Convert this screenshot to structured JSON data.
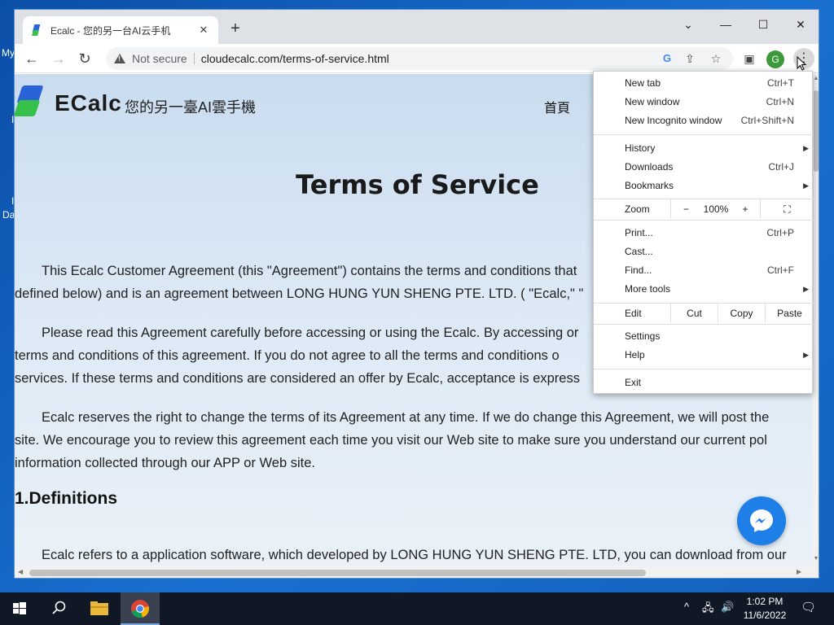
{
  "desktop": {
    "labels": [
      "My",
      "I",
      "I",
      "Da"
    ]
  },
  "browser": {
    "tab": {
      "title": "Ecalc - 您的另一台AI云手机",
      "close": "✕"
    },
    "new_tab": "+",
    "window_controls": {
      "dropdown": "⌄",
      "minimize": "—",
      "maximize": "☐",
      "close": "✕"
    },
    "toolbar": {
      "security_label": "Not secure",
      "url": "cloudecalc.com/terms-of-service.html",
      "profile_initial": "G"
    }
  },
  "page": {
    "site_name": "ECalc",
    "tagline": "您的另一臺AI雲手機",
    "nav_home": "首頁",
    "title": "Terms of Service",
    "paragraphs": [
      {
        "lines": [
          "This Ecalc Customer Agreement (this \"Agreement\") contains the terms and conditions that",
          "defined below) and is an agreement between LONG HUNG YUN SHENG PTE. LTD. (  \"Ecalc,\" \""
        ]
      },
      {
        "lines": [
          "Please read this Agreement carefully before accessing or using the Ecalc. By accessing or",
          "terms and conditions of this agreement. If you do not agree to all the terms and conditions o",
          "services. If these terms and conditions are considered an offer by Ecalc, acceptance is express"
        ]
      },
      {
        "lines": [
          "Ecalc reserves the right to change the terms of its Agreement at any time. If we do change this Agreement, we will post the",
          "site. We encourage you to review this agreement each time you visit our Web site to make sure you understand our current pol",
          "information collected through our APP or Web site."
        ]
      },
      {
        "lines": [
          "Ecalc refers to a application software, which developed by LONG HUNG YUN SHENG PTE. LTD, you can download from our"
        ]
      }
    ],
    "section_title": "1.Definitions"
  },
  "chrome_menu": {
    "group1": [
      {
        "label": "New tab",
        "shortcut": "Ctrl+T"
      },
      {
        "label": "New window",
        "shortcut": "Ctrl+N"
      },
      {
        "label": "New Incognito window",
        "shortcut": "Ctrl+Shift+N"
      }
    ],
    "group2": [
      {
        "label": "History",
        "shortcut": "",
        "submenu": true
      },
      {
        "label": "Downloads",
        "shortcut": "Ctrl+J"
      },
      {
        "label": "Bookmarks",
        "shortcut": "",
        "submenu": true
      }
    ],
    "zoom": {
      "label": "Zoom",
      "minus": "−",
      "level": "100%",
      "plus": "+",
      "fullscreen": "⛶"
    },
    "group3": [
      {
        "label": "Print...",
        "shortcut": "Ctrl+P"
      },
      {
        "label": "Cast...",
        "shortcut": ""
      },
      {
        "label": "Find...",
        "shortcut": "Ctrl+F"
      },
      {
        "label": "More tools",
        "shortcut": "",
        "submenu": true
      }
    ],
    "edit": {
      "label": "Edit",
      "cut": "Cut",
      "copy": "Copy",
      "paste": "Paste"
    },
    "group4": [
      {
        "label": "Settings",
        "shortcut": ""
      },
      {
        "label": "Help",
        "shortcut": "",
        "submenu": true
      }
    ],
    "exit": {
      "label": "Exit"
    }
  },
  "taskbar": {
    "time": "1:02 PM",
    "date": "11/6/2022"
  }
}
